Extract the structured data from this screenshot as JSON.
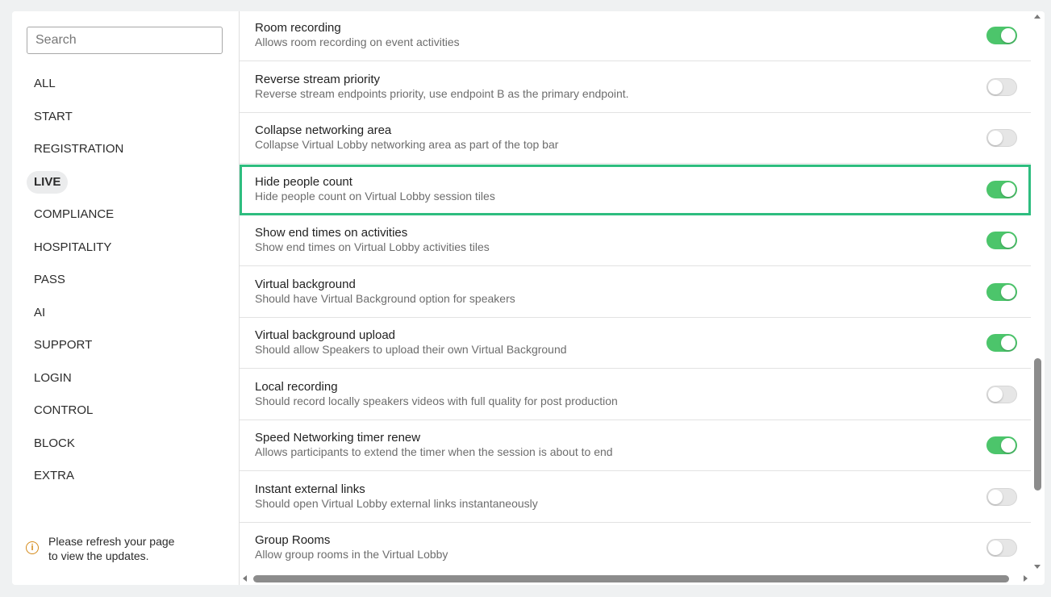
{
  "search": {
    "placeholder": "Search"
  },
  "sidebar": {
    "items": [
      {
        "label": "ALL",
        "active": false
      },
      {
        "label": "START",
        "active": false
      },
      {
        "label": "REGISTRATION",
        "active": false
      },
      {
        "label": "LIVE",
        "active": true
      },
      {
        "label": "COMPLIANCE",
        "active": false
      },
      {
        "label": "HOSPITALITY",
        "active": false
      },
      {
        "label": "PASS",
        "active": false
      },
      {
        "label": "AI",
        "active": false
      },
      {
        "label": "SUPPORT",
        "active": false
      },
      {
        "label": "LOGIN",
        "active": false
      },
      {
        "label": "CONTROL",
        "active": false
      },
      {
        "label": "BLOCK",
        "active": false
      },
      {
        "label": "EXTRA",
        "active": false
      }
    ],
    "notice": {
      "icon": "info-icon",
      "line1": "Please refresh your page",
      "line2": "to view the updates."
    }
  },
  "settings": [
    {
      "title": "Room recording",
      "description": "Allows room recording on event activities",
      "enabled": true,
      "highlighted": false
    },
    {
      "title": "Reverse stream priority",
      "description": "Reverse stream endpoints priority, use endpoint B as the primary endpoint.",
      "enabled": false,
      "highlighted": false
    },
    {
      "title": "Collapse networking area",
      "description": "Collapse Virtual Lobby networking area as part of the top bar",
      "enabled": false,
      "highlighted": false
    },
    {
      "title": "Hide people count",
      "description": "Hide people count on Virtual Lobby session tiles",
      "enabled": true,
      "highlighted": true
    },
    {
      "title": "Show end times on activities",
      "description": "Show end times on Virtual Lobby activities tiles",
      "enabled": true,
      "highlighted": false
    },
    {
      "title": "Virtual background",
      "description": "Should have Virtual Background option for speakers",
      "enabled": true,
      "highlighted": false
    },
    {
      "title": "Virtual background upload",
      "description": "Should allow Speakers to upload their own Virtual Background",
      "enabled": true,
      "highlighted": false
    },
    {
      "title": "Local recording",
      "description": "Should record locally speakers videos with full quality for post production",
      "enabled": false,
      "highlighted": false
    },
    {
      "title": "Speed Networking timer renew",
      "description": "Allows participants to extend the timer when the session is about to end",
      "enabled": true,
      "highlighted": false
    },
    {
      "title": "Instant external links",
      "description": "Should open Virtual Lobby external links instantaneously",
      "enabled": false,
      "highlighted": false
    },
    {
      "title": "Group Rooms",
      "description": "Allow group rooms in the Virtual Lobby",
      "enabled": false,
      "highlighted": false
    }
  ],
  "colors": {
    "toggle_on": "#4cc56b",
    "toggle_off": "#e6e6e6",
    "highlight_border": "#2ebd7f",
    "notice_icon": "#d48a1a"
  }
}
